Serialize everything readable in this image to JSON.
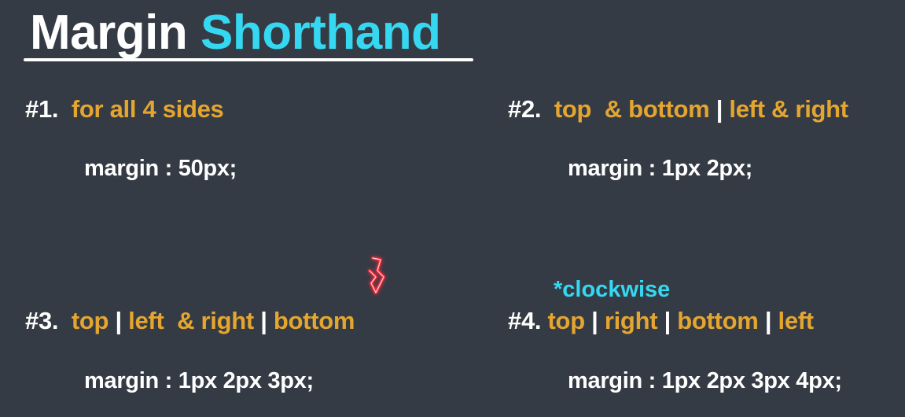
{
  "title": {
    "word1": "Margin",
    "word2": "Shorthand"
  },
  "sections": [
    {
      "num": "#1.",
      "parts": [
        "for all 4 sides"
      ],
      "code": "margin : 50px;"
    },
    {
      "num": "#2.",
      "parts": [
        "top  & bottom",
        "left & right"
      ],
      "code": "margin : 1px 2px;"
    },
    {
      "num": "#3.",
      "parts": [
        "top",
        "left  & right",
        "bottom"
      ],
      "code": "margin : 1px 2px 3px;"
    },
    {
      "num": "#4.",
      "parts": [
        "top",
        "right",
        "bottom",
        "left"
      ],
      "code": "margin : 1px 2px 3px 4px;"
    }
  ],
  "separator": "|",
  "note": "*clockwise",
  "colors": {
    "background": "#353b44",
    "accent_cyan": "#35d8f0",
    "accent_orange": "#e5a630",
    "text_white": "#ffffff",
    "cursor_red": "#ff2a3a"
  },
  "icons": {
    "cursor": "red-hand-drawn-pointer-icon"
  }
}
